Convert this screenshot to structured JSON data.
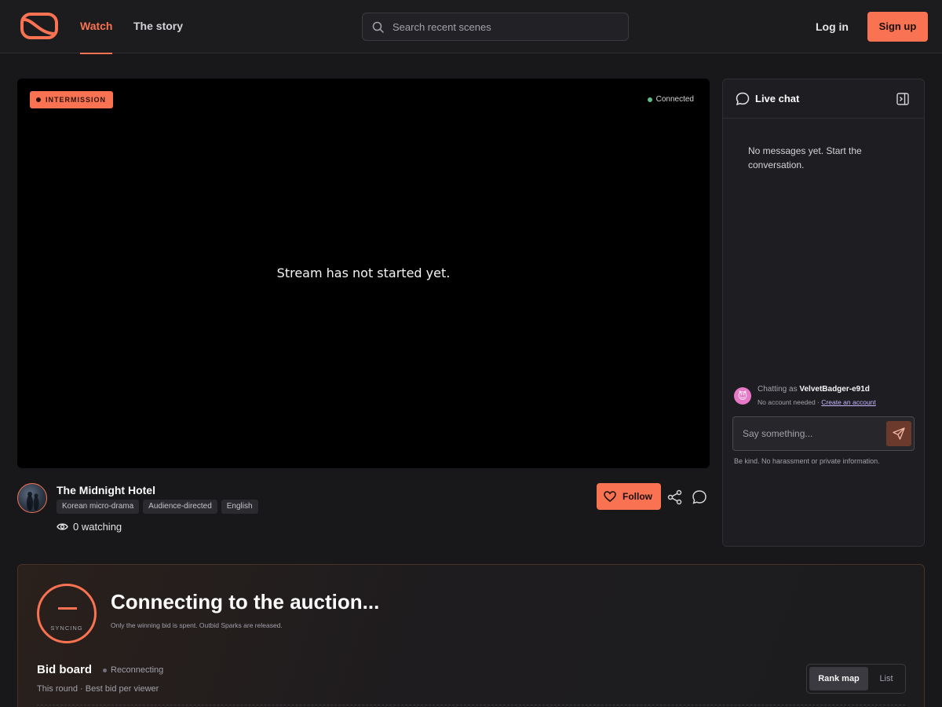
{
  "header": {
    "tabs": [
      {
        "label": "Watch",
        "active": true
      },
      {
        "label": "The story",
        "active": false
      }
    ],
    "search_placeholder": "Search recent scenes",
    "login_label": "Log in",
    "signup_label": "Sign up"
  },
  "player": {
    "status_badge": "INTERMISSION",
    "connection_status": "Connected",
    "message": "Stream has not started yet."
  },
  "channel": {
    "title": "The Midnight Hotel",
    "tags": [
      "Korean micro-drama",
      "Audience-directed",
      "English"
    ],
    "watching": "0 watching",
    "follow_label": "Follow"
  },
  "chat": {
    "title": "Live chat",
    "empty_message": "No messages yet. Start the conversation.",
    "chatting_as_label": "Chatting as",
    "username": "VelvetBadger-e91d",
    "no_account_text": "No account needed ·",
    "create_account_link": "Create an account",
    "input_placeholder": "Say something...",
    "rules": "Be kind. No harassment or private information."
  },
  "auction": {
    "sync_label": "SYNCING",
    "title": "Connecting to the auction...",
    "subtitle": "Only the winning bid is spent. Outbid Sparks are released.",
    "bid_board_title": "Bid board",
    "bid_board_status": "Reconnecting",
    "bid_board_subtitle": "This round · Best bid per viewer",
    "view_options": [
      {
        "label": "Rank map",
        "active": true
      },
      {
        "label": "List",
        "active": false
      }
    ]
  },
  "colors": {
    "accent": "#f97352",
    "background": "#18181b",
    "connected": "#5fbf8a"
  },
  "icons": [
    "logo-icon",
    "search-icon",
    "eye-icon",
    "heart-icon",
    "share-icon",
    "comment-icon",
    "chat-bubble-icon",
    "panel-collapse-icon",
    "send-icon",
    "user-avatar-icon"
  ]
}
